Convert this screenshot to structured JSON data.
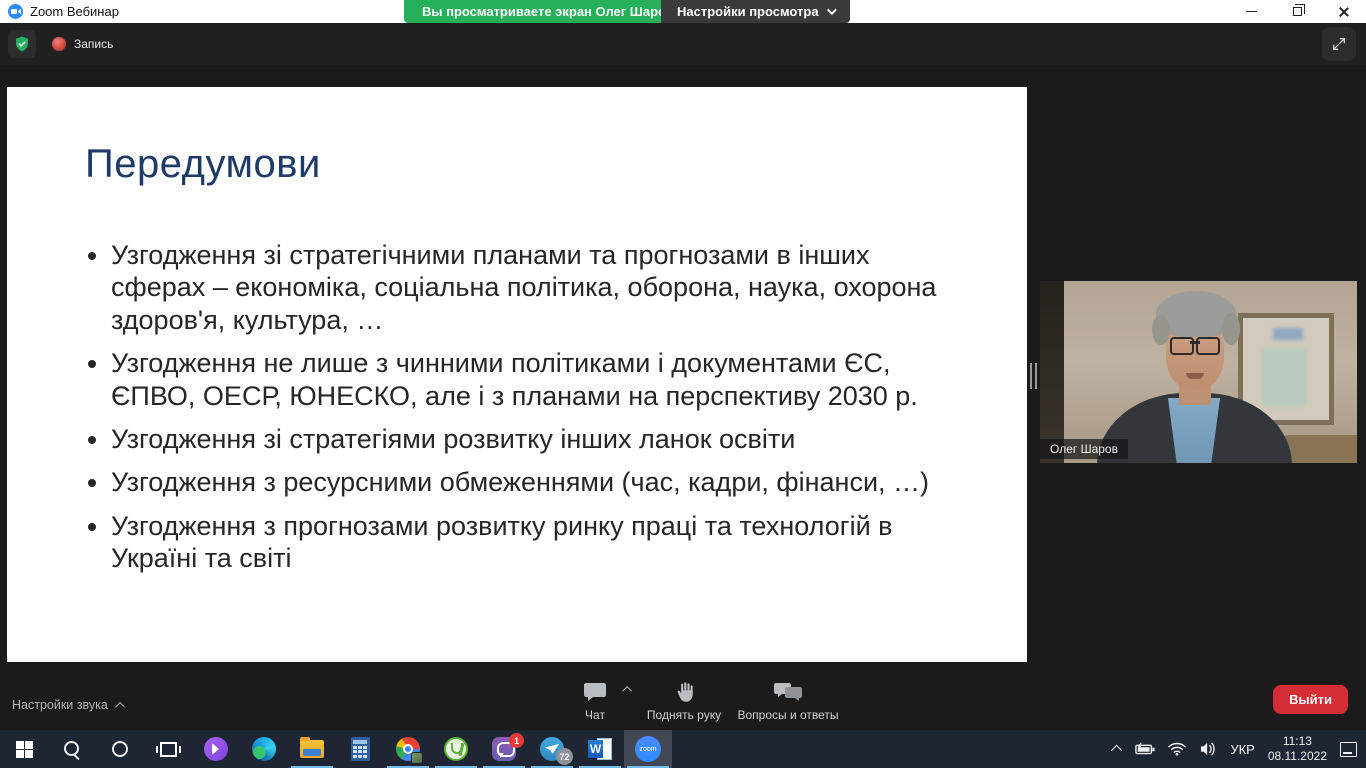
{
  "window": {
    "app_title": "Zoom Вебинар",
    "share_banner": "Вы просматриваете экран Олег Шаров",
    "view_settings_label": "Настройки просмотра",
    "recording_label": "Запись"
  },
  "slide": {
    "title": "Передумови",
    "bullets": [
      "Узгодження зі стратегічними планами та прогнозами в інших сферах – економіка, соціальна політика, оборона, наука, охорона здоров'я, культура, …",
      "Узгодження не лише з чинними політиками і документами ЄС, ЄПВО, ОЕСР, ЮНЕСКО, але і з планами на перспективу 2030 р.",
      "Узгодження зі стратегіями розвитку інших ланок освіти",
      "Узгодження з ресурсними обмеженнями (час, кадри, фінанси, …)",
      "Узгодження з прогнозами розвитку ринку праці та технологій в Україні та світі"
    ]
  },
  "participant": {
    "name": "Олег Шаров"
  },
  "controls": {
    "audio_settings_label": "Настройки звука",
    "chat_label": "Чат",
    "raise_hand_label": "Поднять руку",
    "qa_label": "Вопросы и ответы",
    "leave_label": "Выйти"
  },
  "taskbar": {
    "language_label": "УКР",
    "time": "11:13",
    "date": "08.11.2022",
    "viber_badge": "1",
    "telegram_badge": "72",
    "zoom_icon_text": "zoom",
    "word_icon_text": "W"
  },
  "colors": {
    "banner_green": "#27b05a",
    "leave_red": "#d42d35",
    "slide_title_navy": "#1f3a68",
    "taskbar_bg": "#1e2633",
    "underline_blue": "#76b9ed"
  }
}
